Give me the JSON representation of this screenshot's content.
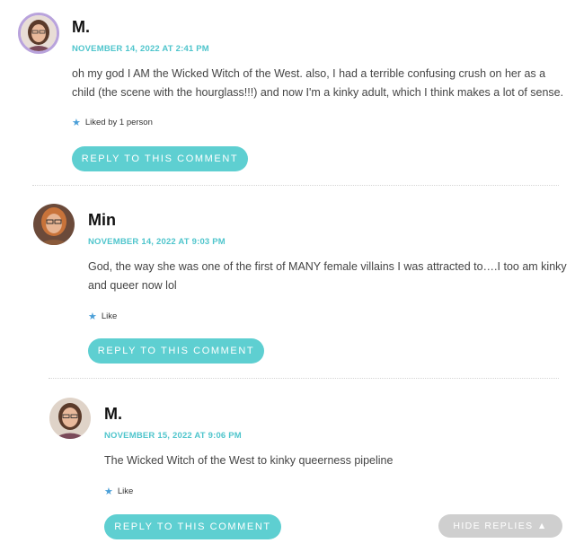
{
  "comments": [
    {
      "author": "M.",
      "date": "NOVEMBER 14, 2022 AT 2:41 PM",
      "text_line1": "oh my god I AM the Wicked Witch of the West. also, I had a terrible confusing crush on her as a",
      "text_line2": "child (the scene with the hourglass!!!) and now I'm a kinky adult, which I think makes a lot of sense.",
      "like_label": "Liked by 1 person",
      "reply_label": "REPLY TO THIS COMMENT"
    },
    {
      "author": "Min",
      "date": "NOVEMBER 14, 2022 AT 9:03 PM",
      "text_line1": "God, the way she was one of the first of MANY female villains I was attracted to….I too am kinky",
      "text_line2": "and queer now lol",
      "like_label": "Like",
      "reply_label": "REPLY TO THIS COMMENT"
    },
    {
      "author": "M.",
      "date": "NOVEMBER 15, 2022 AT 9:06 PM",
      "text_line1": "The Wicked Witch of the West to kinky queerness pipeline",
      "like_label": "Like",
      "reply_label": "REPLY TO THIS COMMENT"
    }
  ],
  "hide_replies_label": "HIDE REPLIES ▲",
  "colors": {
    "accent": "#5ecfd1",
    "date": "#4fc5cc",
    "star": "#4a9fd8",
    "hide_button": "#cfcfcf"
  }
}
